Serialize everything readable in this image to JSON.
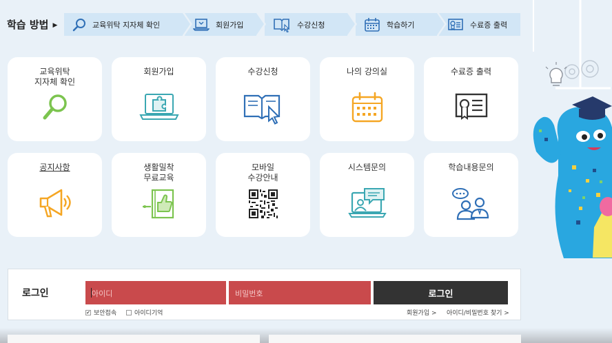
{
  "steps": {
    "title": "학습 방법",
    "items": [
      {
        "label": "교육위탁 지자체 확인",
        "icon": "search-icon"
      },
      {
        "label": "회원가입",
        "icon": "laptop-icon"
      },
      {
        "label": "수강신청",
        "icon": "book-cursor-icon"
      },
      {
        "label": "학습하기",
        "icon": "calendar-icon"
      },
      {
        "label": "수료증 출력",
        "icon": "certificate-icon"
      }
    ]
  },
  "cards": [
    {
      "label": "교육위탁\n지자체 확인",
      "icon": "search-icon"
    },
    {
      "label": "회원가입",
      "icon": "laptop-puzzle-icon"
    },
    {
      "label": "수강신청",
      "icon": "book-cursor-icon"
    },
    {
      "label": "나의 강의실",
      "icon": "calendar-icon"
    },
    {
      "label": "수료증 출력",
      "icon": "certificate-icon"
    },
    {
      "label": "공지사항",
      "icon": "megaphone-icon"
    },
    {
      "label": "생활밀착\n무료교육",
      "icon": "thumbs-up-book-icon"
    },
    {
      "label": "모바일\n수강안내",
      "icon": "qr-code-icon"
    },
    {
      "label": "시스템문의",
      "icon": "computer-chat-icon"
    },
    {
      "label": "학습내용문의",
      "icon": "people-chat-icon"
    }
  ],
  "login": {
    "title": "로그인",
    "id_placeholder": "아이디",
    "pw_placeholder": "비밀번호",
    "button": "로그인",
    "secure": "보안접속",
    "remember": "아이디기억",
    "signup_link": "회원가입 >",
    "find_link": "아이디/비밀번호 찾기 >"
  },
  "colors": {
    "background": "#e9f1f8",
    "step_bg": "#d2e6f6",
    "input_red": "#c94a4c",
    "button_dark": "#333333",
    "green": "#7cc44f",
    "teal": "#3aa7b2",
    "blue": "#2f6fb6",
    "orange": "#f5a623"
  }
}
